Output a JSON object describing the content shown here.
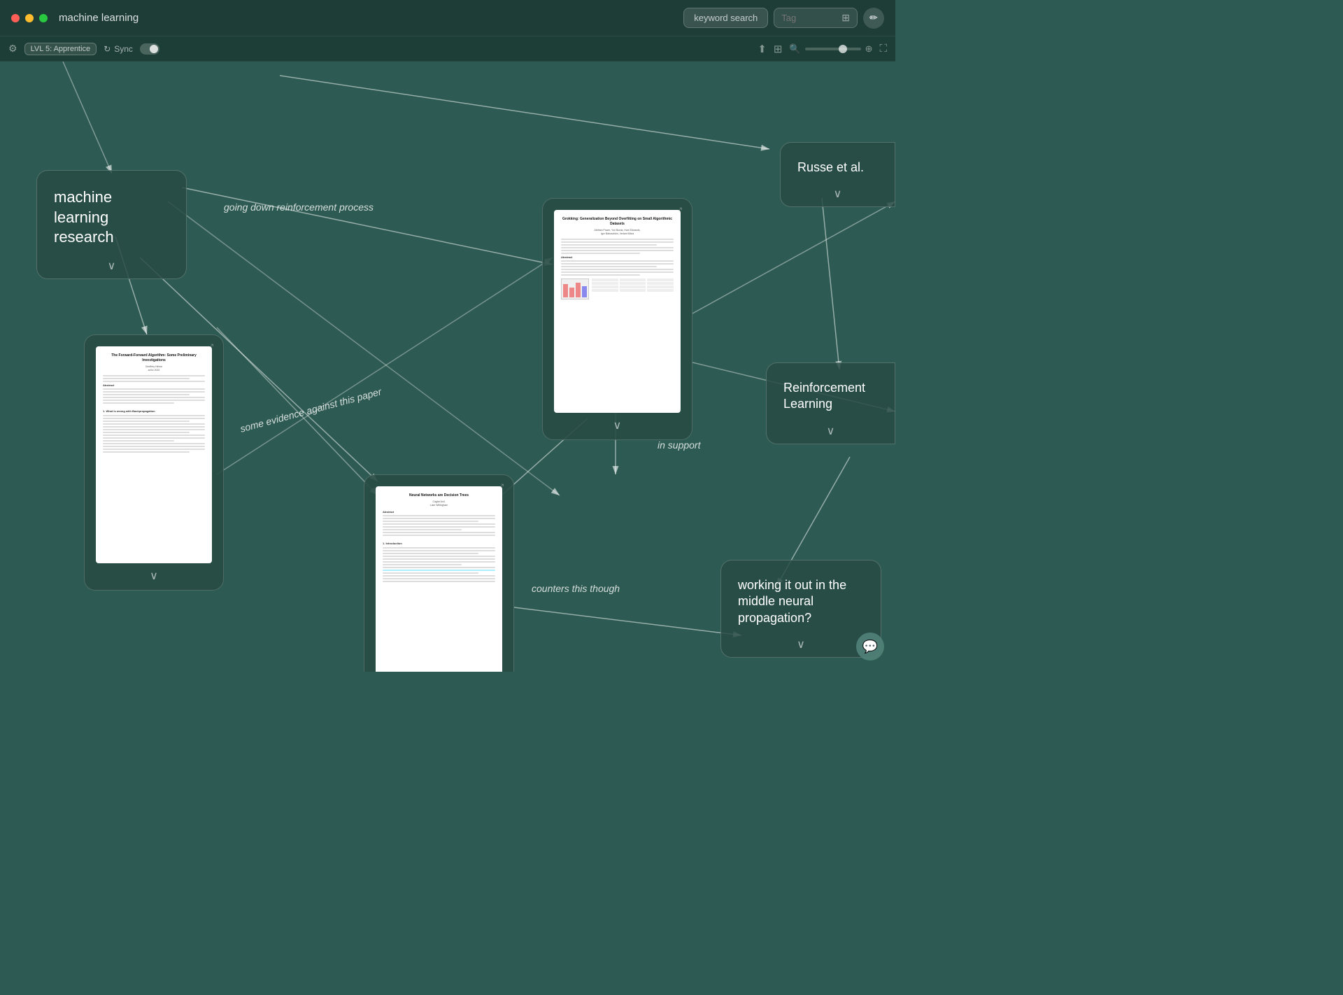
{
  "titlebar": {
    "app_title": "machine learning",
    "search_placeholder": "keyword search",
    "tag_placeholder": "Tag",
    "dots": [
      "red",
      "yellow",
      "green"
    ]
  },
  "toolbar": {
    "level_badge": "LVL 5: Apprentice",
    "sync_label": "Sync",
    "settings_icon": "⚙",
    "sync_icon": "↻"
  },
  "cards": {
    "main_node": {
      "title": "machine learning research",
      "chevron": "∨"
    },
    "russe": {
      "title": "Russe et al.",
      "chevron": "∨"
    },
    "reinforcement": {
      "title": "Reinforcement Learning",
      "chevron": "∨"
    },
    "neural_prop": {
      "title": "working it out in the middle neural propagation?",
      "chevron": "∨"
    }
  },
  "papers": {
    "forward_forward": {
      "title": "The Forward-Forward Algorithm: Some Preliminary Investigations",
      "expand_icon": "⤢",
      "chevron": "∨"
    },
    "grokking": {
      "title": "Grokking: Generalization Beyond Overfitting on Small Algorithmic Datasets",
      "expand_icon": "⤢",
      "chevron": "∨"
    },
    "neural_networks": {
      "title": "Neural Networks are Decision Trees",
      "expand_icon": "⤢",
      "chevron": "∨"
    }
  },
  "edge_labels": {
    "going_down": "going down reinforcement\nprocess",
    "some_evidence": "some evidence against this\npaper",
    "in_support": "in support",
    "counters_this": "counters this though"
  },
  "chat_btn": "💬"
}
